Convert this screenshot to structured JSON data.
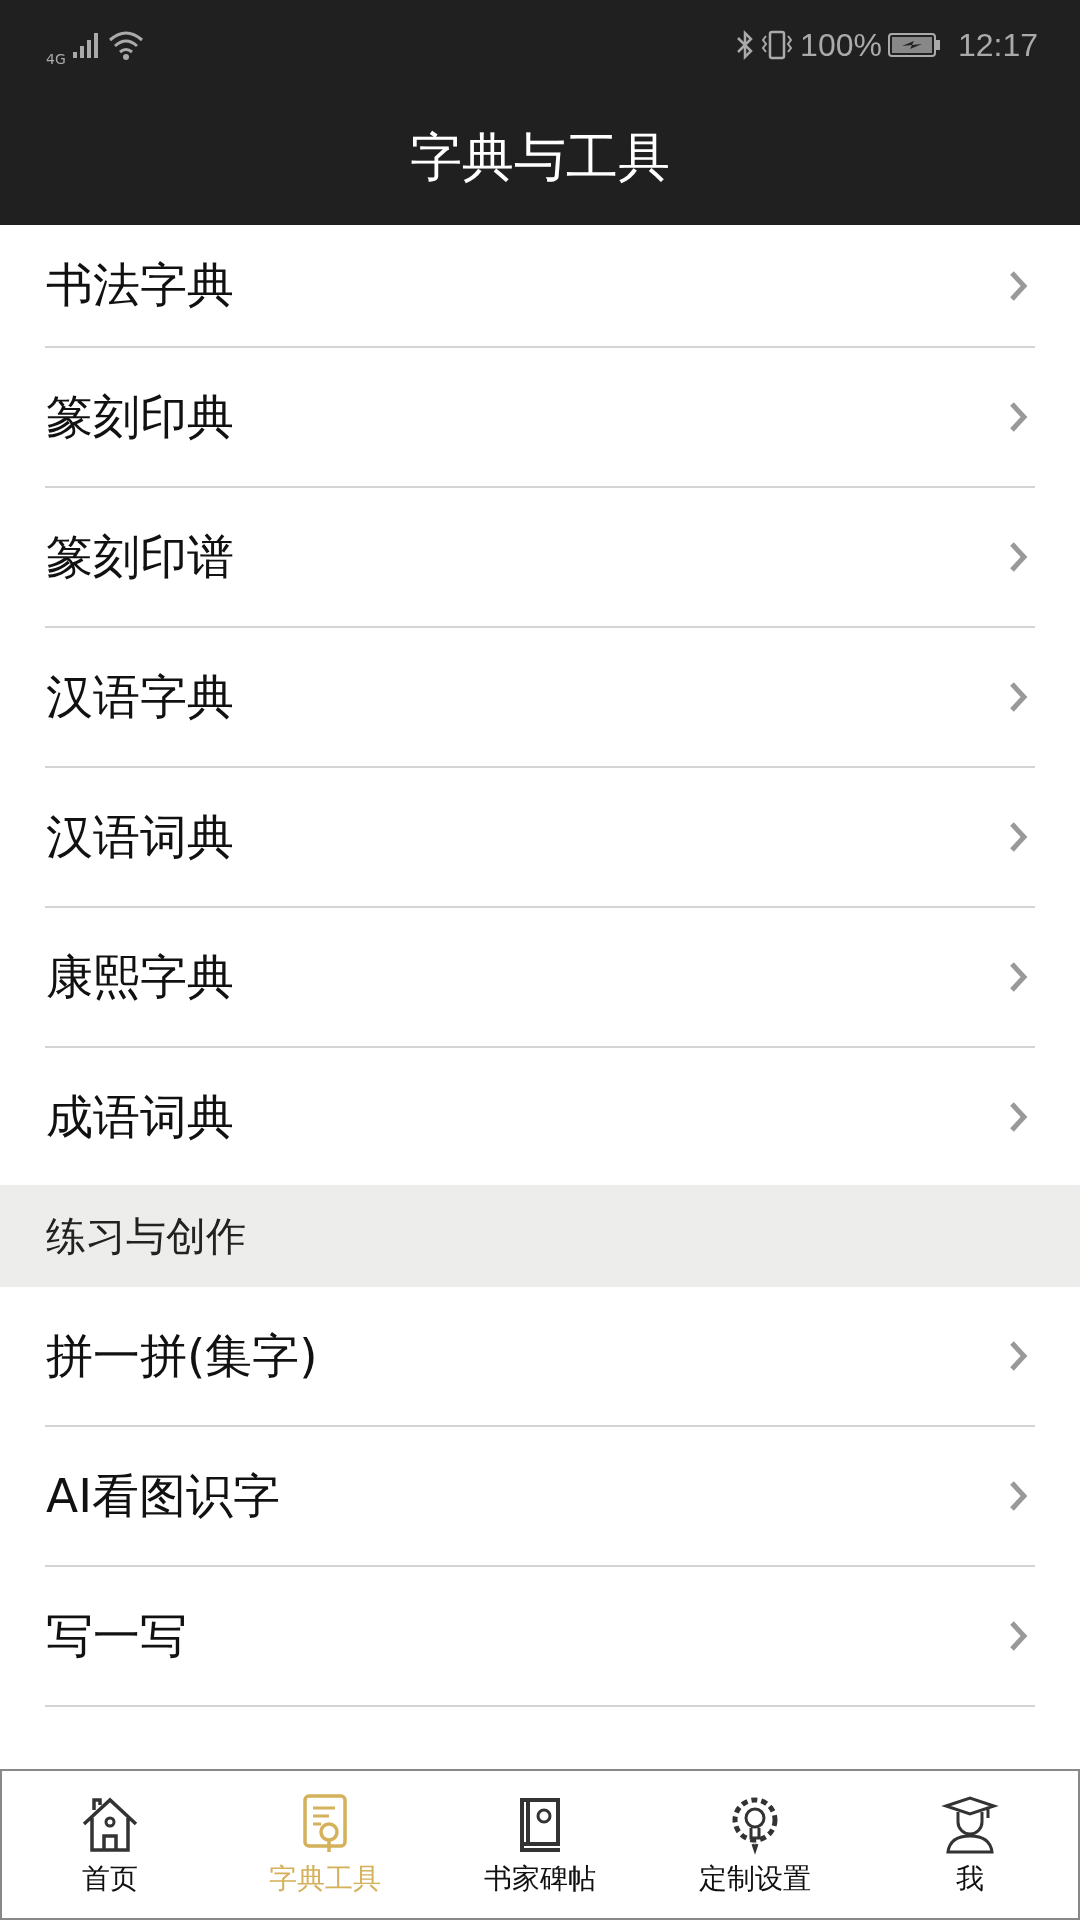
{
  "status_bar": {
    "network": "4G",
    "battery": "100%",
    "time": "12:17"
  },
  "title": "字典与工具",
  "sections": [
    {
      "items": [
        "书法字典",
        "篆刻印典",
        "篆刻印谱",
        "汉语字典",
        "汉语词典",
        "康熙字典",
        "成语词典"
      ]
    },
    {
      "header": "练习与创作",
      "items": [
        "拼一拼(集字)",
        "AI看图识字",
        "写一写"
      ]
    }
  ],
  "tab_bar": [
    {
      "label": "首页",
      "selected": false
    },
    {
      "label": "字典工具",
      "selected": true
    },
    {
      "label": "书家碑帖",
      "selected": false
    },
    {
      "label": "定制设置",
      "selected": false
    },
    {
      "label": "我",
      "selected": false
    }
  ]
}
